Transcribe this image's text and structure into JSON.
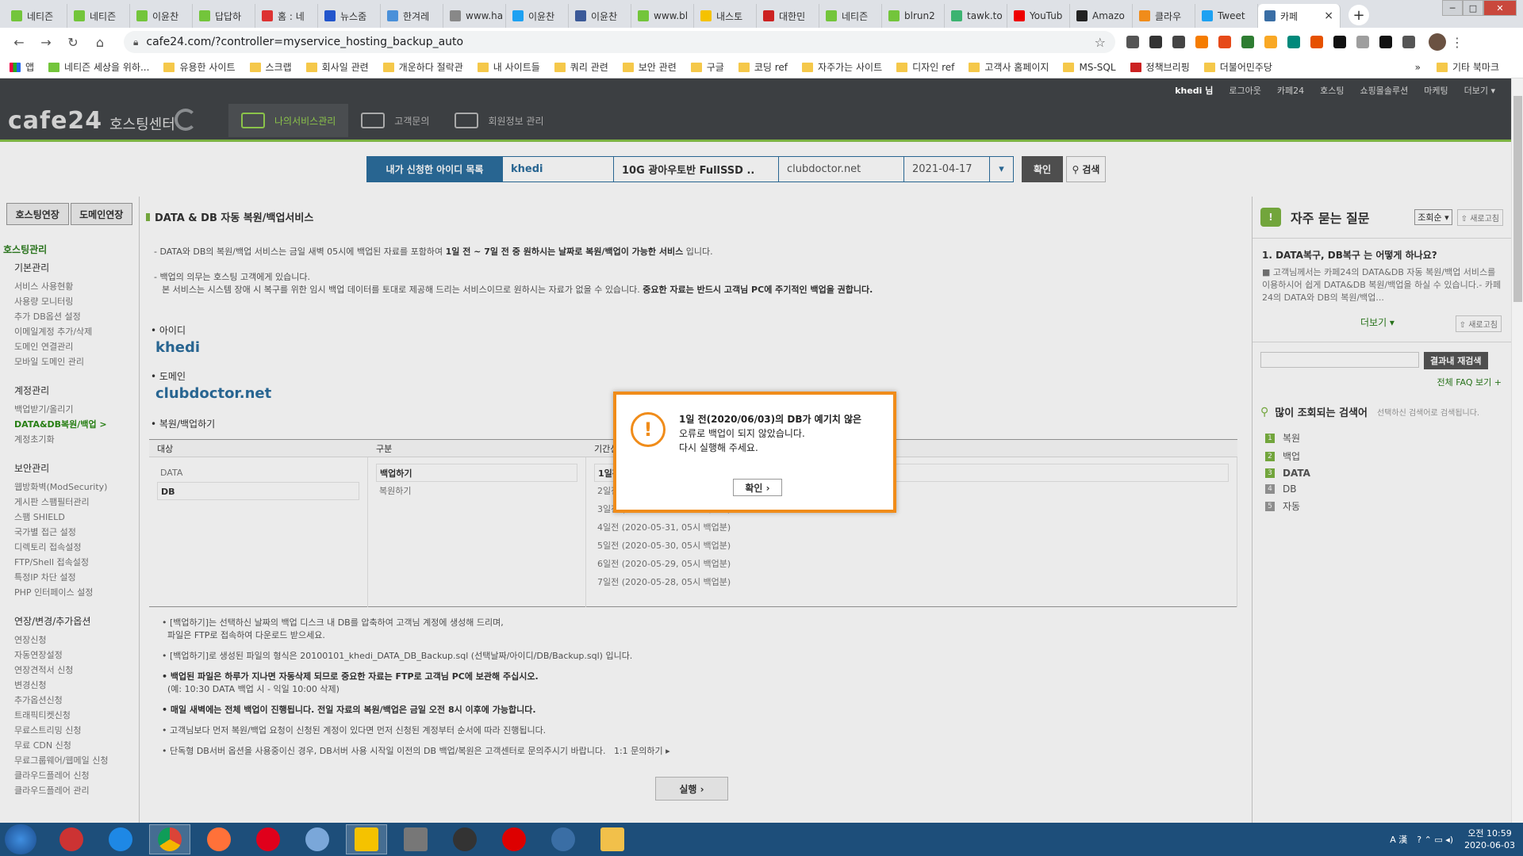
{
  "browser": {
    "tabs": [
      {
        "label": "네티즌",
        "color": "#73c53b"
      },
      {
        "label": "네티즌",
        "color": "#73c53b"
      },
      {
        "label": "이윤찬",
        "color": "#73c53b"
      },
      {
        "label": "답답하",
        "color": "#73c53b"
      },
      {
        "label": "홈 : 네",
        "color": "#d33"
      },
      {
        "label": "뉴스줌",
        "color": "#2255cc"
      },
      {
        "label": "한겨레",
        "color": "#4a90d9"
      },
      {
        "label": "www.ha",
        "color": "#888"
      },
      {
        "label": "이윤찬",
        "color": "#1da1f2"
      },
      {
        "label": "이윤찬",
        "color": "#3b5998"
      },
      {
        "label": "www.bl",
        "color": "#73c53b"
      },
      {
        "label": "내스토",
        "color": "#f5c200"
      },
      {
        "label": "대한민",
        "color": "#c22"
      },
      {
        "label": "네티즌",
        "color": "#73c53b"
      },
      {
        "label": "blrun2",
        "color": "#73c53b"
      },
      {
        "label": "tawk.to",
        "color": "#3cb371"
      },
      {
        "label": "YouTub",
        "color": "#e00"
      },
      {
        "label": "Amazo",
        "color": "#222"
      },
      {
        "label": "클라우",
        "color": "#f08c1a"
      },
      {
        "label": "Tweet",
        "color": "#1da1f2"
      }
    ],
    "active_tab": {
      "label": "카페",
      "color": "#3a6ea5"
    },
    "url": "cafe24.com/?controller=myservice_hosting_backup_auto",
    "bookmarks": [
      "앱",
      "네티즌 세상을 위하...",
      "유용한 사이트",
      "스크랩",
      "회사일 관련",
      "개운하다 절락관",
      "내 사이트들",
      "쿼리 관련",
      "보안 관련",
      "구글",
      "코딩 ref",
      "자주가는 사이트",
      "디자인 ref",
      "고객사 홈페이지",
      "MS-SQL",
      "정책브리핑",
      "더불어민주당"
    ],
    "bookmarks_other": "기타 북마크",
    "bookmarks_more": "»"
  },
  "site": {
    "logo": "cafe24",
    "logo_sub": "호스팅센터",
    "nav": [
      "나의서비스관리",
      "고객문의",
      "회원정보 관리"
    ],
    "util": {
      "user": "khedi 님",
      "links": [
        "로그아웃",
        "카페24",
        "호스팅",
        "쇼핑몰솔루션",
        "마케팅",
        "더보기 ▾"
      ]
    }
  },
  "selector": {
    "label": "내가 신청한 아이디 목록",
    "id": "khedi",
    "service": "10G 광아우토반 FullSSD ..",
    "domain": "clubdoctor.net",
    "date": "2021-04-17",
    "dropdown": "▾",
    "confirm": "확인",
    "search": "검색"
  },
  "sidebar": {
    "buttons": [
      "호스팅연장",
      "도메인연장"
    ],
    "main_header": "호스팅관리",
    "groups": [
      {
        "title": "기본관리",
        "items": [
          "서비스 사용현황",
          "사용량 모니터링",
          "추가 DB옵션 설정",
          "이메일계정 추가/삭제",
          "도메인 연결관리",
          "모바일 도메인 관리"
        ]
      },
      {
        "title": "계정관리",
        "items": [
          "백업받기/올리기",
          "DATA&DB복원/백업 >",
          "계정초기화"
        ]
      },
      {
        "title": "보안관리",
        "items": [
          "웹방화벽(ModSecurity)",
          "게시판 스팸필터관리",
          "스팸 SHIELD",
          "국가별 접근 설정",
          "디렉토리 접속설정",
          "FTP/Shell 접속설정",
          "특정IP 차단 설정",
          "PHP 인터페이스 설정"
        ]
      },
      {
        "title": "연장/변경/추가옵션",
        "items": [
          "연장신청",
          "자동연장설정",
          "연장견적서 신청",
          "변경신청",
          "추가옵션신청",
          "트래픽티켓신청",
          "무료스트리밍 신청",
          "무료 CDN 신청",
          "무료그룹웨어/웹메일 신청",
          "클라우드플레어 신청",
          "클라우드플레어 관리"
        ]
      }
    ]
  },
  "main": {
    "title": "DATA & DB 자동 복원/백업서비스",
    "desc1_pre": "- DATA와 DB의 복원/백업 서비스는 금일 새벽 05시에 백업된 자료를 포함하여 ",
    "desc1_bold": "1일 전 ~ 7일 전 중 원하시는 날짜로 복원/백업이 가능한 서비스",
    "desc1_post": " 입니다.",
    "desc2": "- 백업의 의무는 호스팅 고객에게 있습니다.",
    "desc3_pre": "본 서비스는 시스템 장애 시 복구를 위한 임시 백업 데이터를 토대로 제공해 드리는 서비스이므로 원하시는 자료가 없을 수 있습니다. ",
    "desc3_bold": "중요한 자료는 반드시 고객님 PC에 주기적인 백업을 권합니다.",
    "id_label": "• 아이디",
    "id_value": "khedi",
    "domain_label": "• 도메인",
    "domain_value": "clubdoctor.net",
    "backup_label": "• 복원/백업하기",
    "table": {
      "headers": [
        "대상",
        "구분",
        "기간선택"
      ],
      "targets": [
        "DATA",
        "DB"
      ],
      "types": [
        "백업하기",
        "복원하기"
      ],
      "periods": [
        "1일전 (2020-06-03, 05시 백업분)",
        "2일전 (2020-06-02, 05시 백업분)",
        "3일전 (2020-06-01, 05시 백업분)",
        "4일전 (2020-05-31, 05시 백업분)",
        "5일전 (2020-05-30, 05시 백업분)",
        "6일전 (2020-05-29, 05시 백업분)",
        "7일전 (2020-05-28, 05시 백업분)"
      ]
    },
    "notes": [
      {
        "text": "• [백업하기]는 선택하신 날짜의 백업 디스크 내 DB를 압축하여 고객님 계정에 생성해 드리며,"
      },
      {
        "text": "  파일은 FTP로 접속하여 다운로드 받으세요."
      },
      {
        "text": "• [백업하기]로 생성된 파일의 형식은 20100101_khedi_DATA_DB_Backup.sql (선택날짜/아이디/DB/Backup.sql) 입니다."
      },
      {
        "text": "• 백업된 파일은 하루가 지나면 자동삭제 되므로 중요한 자료는 FTP로 고객님 PC에 보관해 주십시오.",
        "bold": true
      },
      {
        "text": "  (예: 10:30 DATA 백업 시 - 익일 10:00 삭제)"
      },
      {
        "text": "• 매일 새벽에는 전체 백업이 진행됩니다. 전일 자료의 복원/백업은 금일 오전 8시 이후에 가능합니다.",
        "bold": true
      },
      {
        "text": "• 고객님보다 먼저 복원/백업 요청이 신청된 계정이 있다면 먼저 신청된 계정부터 순서에 따라 진행됩니다."
      },
      {
        "text": "• 단독형 DB서버 옵션을 사용중이신 경우, DB서버 사용 시작일 이전의 DB 백업/복원은 고객센터로 문의주시기 바랍니다.   1:1 문의하기 ▸"
      }
    ],
    "run": "실행 ›"
  },
  "right": {
    "faq_title": "자주 묻는 질문",
    "sort": "조회순 ▾",
    "refresh": "⇧ 새로고침",
    "faq_q": "1. DATA복구, DB복구 는 어떻게 하나요?",
    "faq_a": "■ 고객님께서는 카페24의 DATA&DB 자동 복원/백업 서비스를 이용하시어 쉽게 DATA&DB 복원/백업을 하실 수 있습니다.- 카페24의 DATA와 DB의 복원/백업...",
    "more": "더보기 ▾",
    "refresh2": "⇧ 새로고침",
    "research": "결과내 재검색",
    "faq_link": "전체 FAQ 보기 +",
    "popular_title": "많이 조회되는 검색어",
    "popular_sub": "선택하신 검색어로 검색됩니다.",
    "popular": [
      "복원",
      "백업",
      "DATA",
      "DB",
      "자동"
    ]
  },
  "dialog": {
    "line1": "1일 전(2020/06/03)의 DB가 예기치 않은",
    "line2": "오류로 백업이 되지 않았습니다.",
    "line3": "다시 실행해 주세요.",
    "ok": "확인 ›"
  },
  "taskbar": {
    "time": "오전 10:59",
    "date": "2020-06-03",
    "ime": "A 漢"
  }
}
